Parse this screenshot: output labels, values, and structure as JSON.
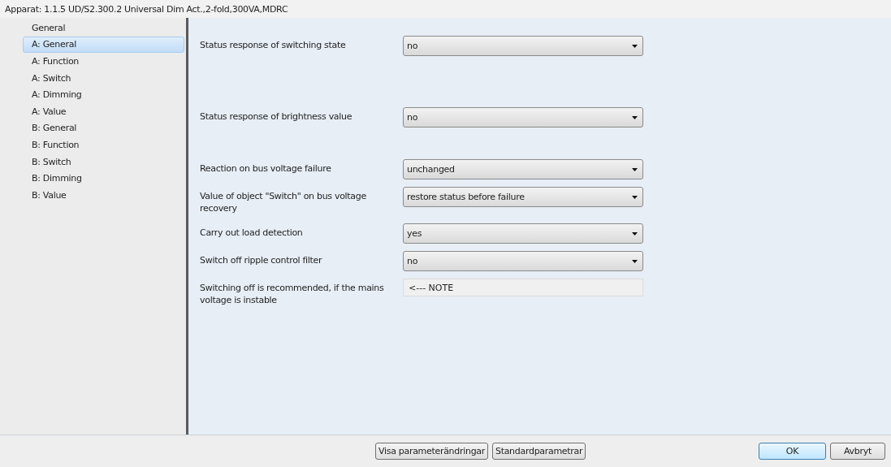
{
  "window": {
    "title": "Apparat: 1.1.5  UD/S2.300.2 Universal Dim Act.,2-fold,300VA,MDRC"
  },
  "sidebar": {
    "items": [
      {
        "label": "General",
        "selected": false
      },
      {
        "label": "A: General",
        "selected": true
      },
      {
        "label": "A: Function",
        "selected": false
      },
      {
        "label": "A: Switch",
        "selected": false
      },
      {
        "label": "A: Dimming",
        "selected": false
      },
      {
        "label": "A: Value",
        "selected": false
      },
      {
        "label": "B: General",
        "selected": false
      },
      {
        "label": "B: Function",
        "selected": false
      },
      {
        "label": "B: Switch",
        "selected": false
      },
      {
        "label": "B: Dimming",
        "selected": false
      },
      {
        "label": "B: Value",
        "selected": false
      }
    ]
  },
  "parameters": [
    {
      "kind": "dropdown",
      "label": "Status response of switching state",
      "value": "no"
    },
    {
      "kind": "dropdown",
      "label": "Status response of brightness value",
      "value": "no"
    },
    {
      "kind": "dropdown",
      "label": "Reaction on bus voltage failure",
      "value": "unchanged"
    },
    {
      "kind": "dropdown",
      "label": "Value of object \"Switch\" on bus voltage recovery",
      "value": "restore status before failure"
    },
    {
      "kind": "dropdown",
      "label": "Carry out load detection",
      "value": "yes"
    },
    {
      "kind": "dropdown",
      "label": "Switch off ripple control filter",
      "value": "no"
    },
    {
      "kind": "note",
      "label": "Switching off is recommended, if the mains voltage is instable",
      "value": "<--- NOTE"
    }
  ],
  "footer": {
    "buttons": [
      {
        "label": "Visa parameterändringar",
        "kind": "secondary"
      },
      {
        "label": "Standardparametrar",
        "kind": "secondary"
      },
      {
        "label": "OK",
        "kind": "default"
      },
      {
        "label": "Avbryt",
        "kind": "secondary"
      }
    ]
  }
}
